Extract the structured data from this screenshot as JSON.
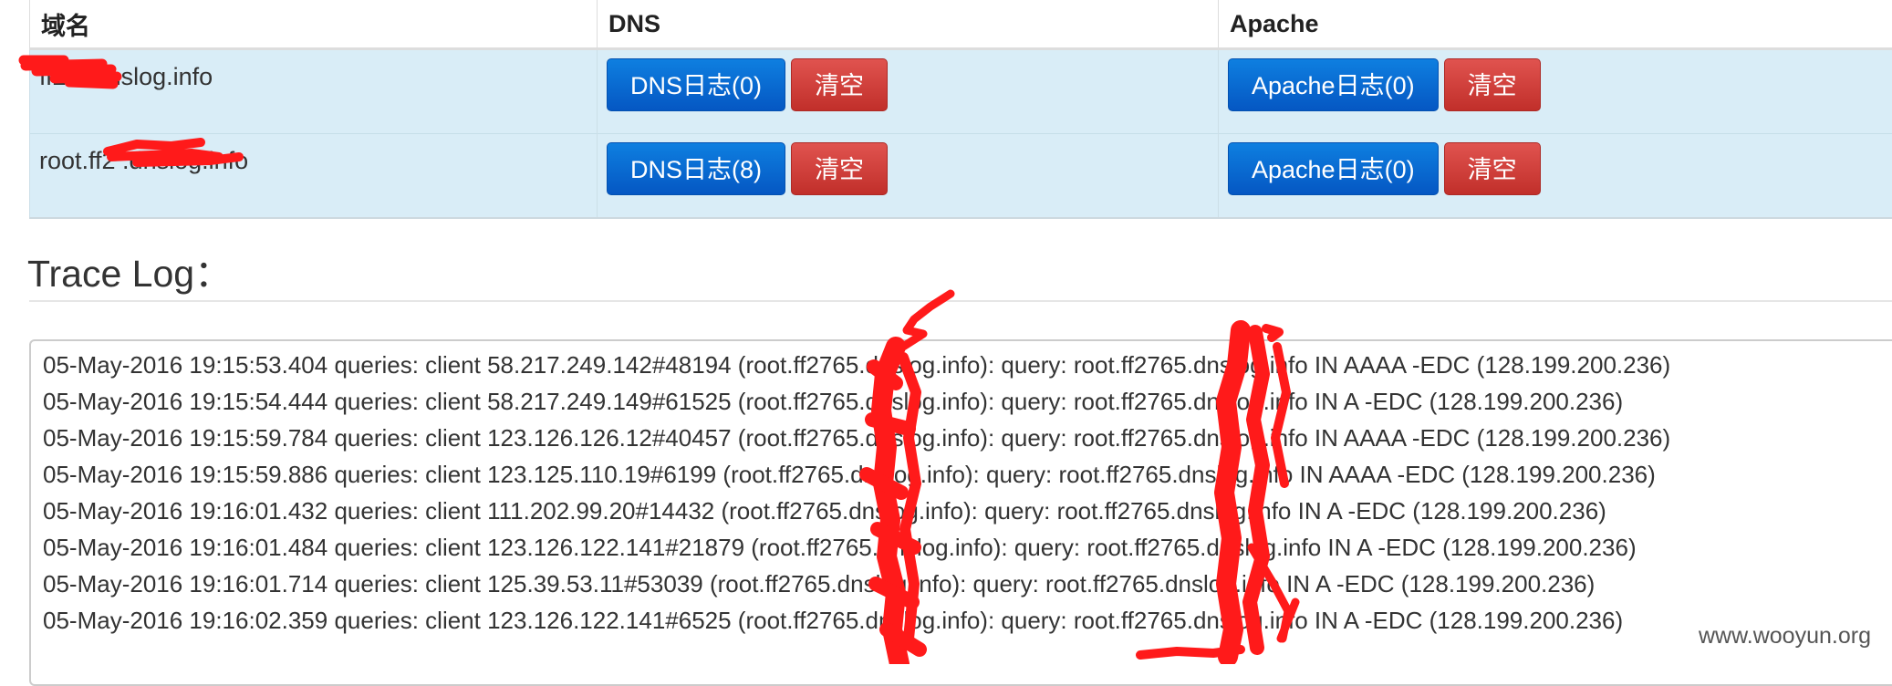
{
  "table": {
    "headers": [
      "域名",
      "DNS",
      "Apache"
    ],
    "rows": [
      {
        "domain": "ff2  5.dnslog.info",
        "dns_button": "DNS日志(0)",
        "dns_clear": "清空",
        "apache_button": "Apache日志(0)",
        "apache_clear": "清空"
      },
      {
        "domain": "root.ff2     .dnslog.info",
        "dns_button": "DNS日志(8)",
        "dns_clear": "清空",
        "apache_button": "Apache日志(0)",
        "apache_clear": "清空"
      }
    ]
  },
  "trace": {
    "heading": "Trace Log：",
    "lines": [
      "05-May-2016 19:15:53.404 queries: client 58.217.249.142#48194 (root.ff2765.dnslog.info): query: root.ff2765.dnslog.info IN AAAA -EDC (128.199.200.236)",
      "05-May-2016 19:15:54.444 queries: client 58.217.249.149#61525 (root.ff2765.dnslog.info): query: root.ff2765.dnslog.info IN A -EDC (128.199.200.236)",
      "05-May-2016 19:15:59.784 queries: client 123.126.126.12#40457 (root.ff2765.dnslog.info): query: root.ff2765.dnslog.info IN AAAA -EDC (128.199.200.236)",
      "05-May-2016 19:15:59.886 queries: client 123.125.110.19#6199 (root.ff2765.dnslog.info): query: root.ff2765.dnslog.info IN AAAA -EDC (128.199.200.236)",
      "05-May-2016 19:16:01.432 queries: client 111.202.99.20#14432 (root.ff2765.dnslog.info): query: root.ff2765.dnslog.info IN A -EDC (128.199.200.236)",
      "05-May-2016 19:16:01.484 queries: client 123.126.122.141#21879 (root.ff2765.dnslog.info): query: root.ff2765.dnslog.info IN A -EDC (128.199.200.236)",
      "05-May-2016 19:16:01.714 queries: client 125.39.53.11#53039 (root.ff2765.dnslog.info): query: root.ff2765.dnslog.info IN A -EDC (128.199.200.236)",
      "05-May-2016 19:16:02.359 queries: client 123.126.122.141#6525 (root.ff2765.dnslog.info): query: root.ff2765.dnslog.info IN A -EDC (128.199.200.236)"
    ]
  },
  "watermark": "www.wooyun.org",
  "colors": {
    "row_bg": "#d9edf7",
    "primary": "#0a67d3",
    "danger": "#d0403b",
    "redaction": "#ff1a1a"
  }
}
